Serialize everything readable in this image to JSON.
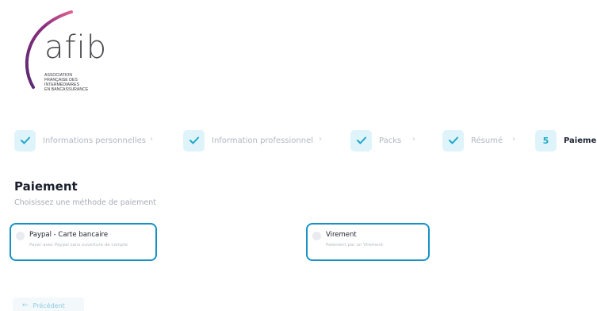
{
  "brand": {
    "wordmark": "afib",
    "subtitle_lines": [
      "ASSOCIATION",
      "FRANÇAISE DES",
      "INTERMÉDIAIRES",
      "EN BANCASSURANCE"
    ],
    "colors": {
      "arc_dark": "#6a2a7a",
      "arc_light": "#d45a8c",
      "accent": "#1ea7c8"
    }
  },
  "stepper": {
    "steps": [
      {
        "label": "Informations personnelles",
        "state": "done",
        "icon": "check-icon"
      },
      {
        "label": "Information professionnel",
        "state": "done",
        "icon": "check-icon"
      },
      {
        "label": "Packs",
        "state": "done",
        "icon": "check-icon"
      },
      {
        "label": "Résumé",
        "state": "done",
        "icon": "check-icon"
      },
      {
        "label": "Paiement",
        "state": "active",
        "number": "5"
      }
    ],
    "separator": "›"
  },
  "section": {
    "title": "Paiement",
    "subtitle": "Choisissez une méthode de paiement"
  },
  "options": [
    {
      "title": "Paypal - Carte bancaire",
      "description": "Payer avec Paypal sans ouverture de compte",
      "selected": false
    },
    {
      "title": "Virement",
      "description": "Paiement par un Virement",
      "selected": false
    }
  ],
  "nav": {
    "prev_label": "Précédent",
    "prev_icon": "arrow-left-icon"
  }
}
